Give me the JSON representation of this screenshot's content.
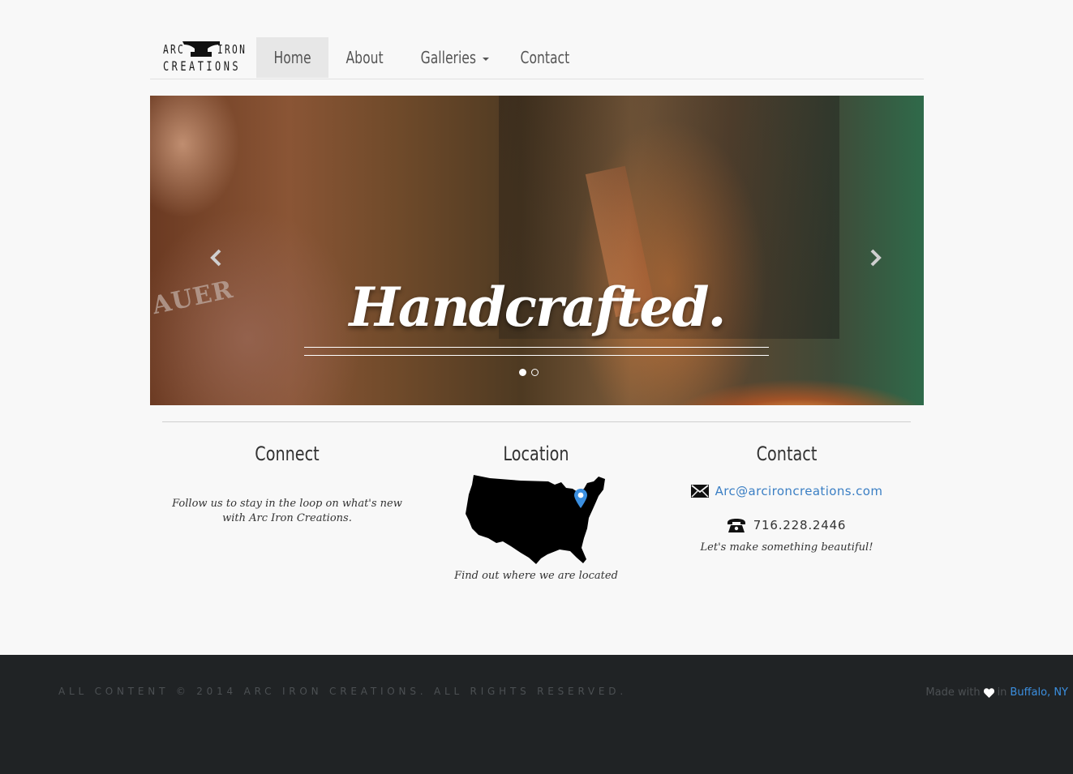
{
  "brand": {
    "line1_left": "ARC",
    "line1_right": "IRON",
    "line2": "CREATIONS"
  },
  "nav": {
    "items": [
      {
        "label": "Home",
        "active": true
      },
      {
        "label": "About"
      },
      {
        "label": "Galleries",
        "dropdown": true
      },
      {
        "label": "Contact"
      }
    ]
  },
  "hero": {
    "caption": "Handcrafted.",
    "shirt_text": "AUER",
    "slide_count": 2,
    "active_slide": 0
  },
  "connect": {
    "heading": "Connect",
    "text_line1": "Follow us to stay in the loop on what's new",
    "text_line2": "with Arc Iron Creations."
  },
  "location": {
    "heading": "Location",
    "caption": "Find out where we are located"
  },
  "contact": {
    "heading": "Contact",
    "email": "Arc@arcironcreations.com",
    "phone": "716.228.2446",
    "tagline": "Let's make something beautiful!"
  },
  "footer": {
    "copyright": "All content © 2014 Arc Iron Creations. All rights reserved.",
    "made_with": "Made with",
    "in": "in",
    "location_link": "Buffalo, NY"
  },
  "colors": {
    "link": "#3b7fc4",
    "footer_bg": "#202325",
    "nav_active_bg": "#e7e7e7",
    "map_pin": "#3b8fe0"
  }
}
